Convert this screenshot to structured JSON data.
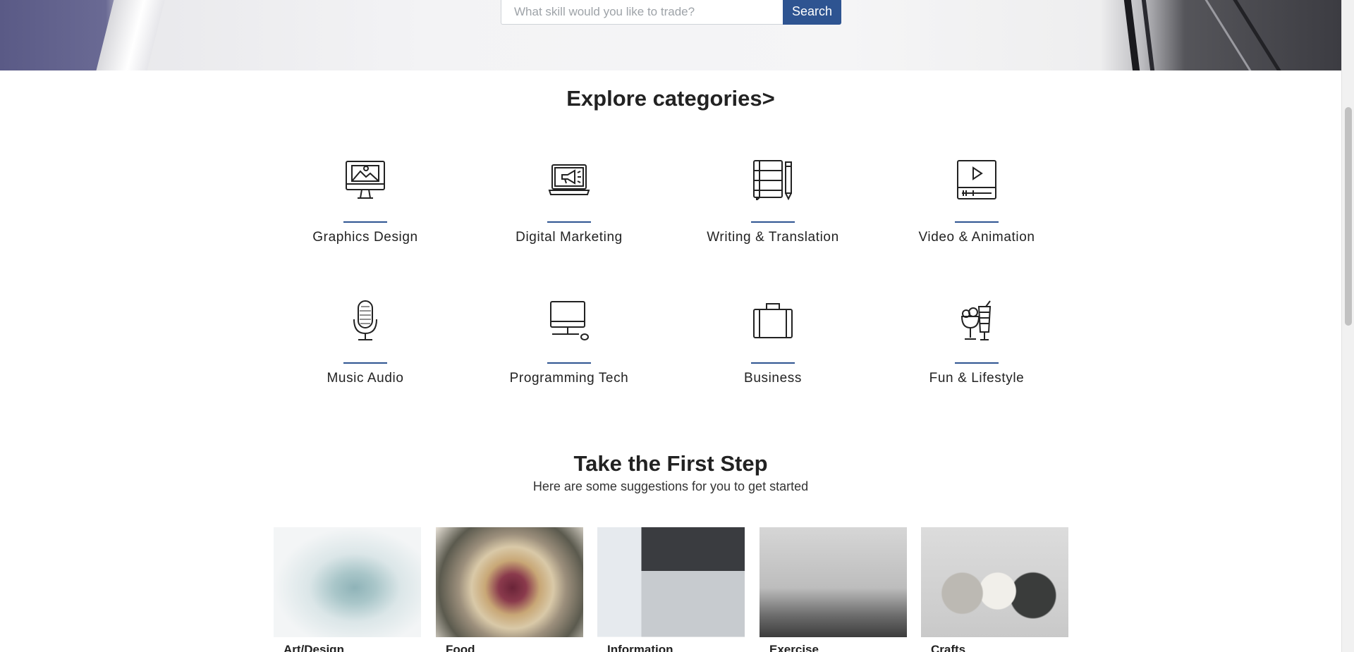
{
  "search": {
    "placeholder": "What skill would you like to trade?",
    "button_label": "Search"
  },
  "explore": {
    "title": "Explore categories>"
  },
  "categories": [
    {
      "label": "Graphics Design",
      "icon": "monitor-image-icon"
    },
    {
      "label": "Digital Marketing",
      "icon": "laptop-megaphone-icon"
    },
    {
      "label": "Writing & Translation",
      "icon": "notebook-pencil-icon"
    },
    {
      "label": "Video & Animation",
      "icon": "video-player-icon"
    },
    {
      "label": "Music Audio",
      "icon": "microphone-icon"
    },
    {
      "label": "Programming Tech",
      "icon": "computer-icon"
    },
    {
      "label": "Business",
      "icon": "briefcase-icon"
    },
    {
      "label": "Fun & Lifestyle",
      "icon": "drinks-icon"
    }
  ],
  "first_step": {
    "title": "Take the First Step",
    "subtitle": "Here are some suggestions for you to get started"
  },
  "cards": [
    {
      "title": "Art/Design"
    },
    {
      "title": "Food"
    },
    {
      "title": "Information"
    },
    {
      "title": "Exercise"
    },
    {
      "title": "Crafts"
    }
  ],
  "colors": {
    "accent": "#2e5491",
    "text": "#222222"
  }
}
